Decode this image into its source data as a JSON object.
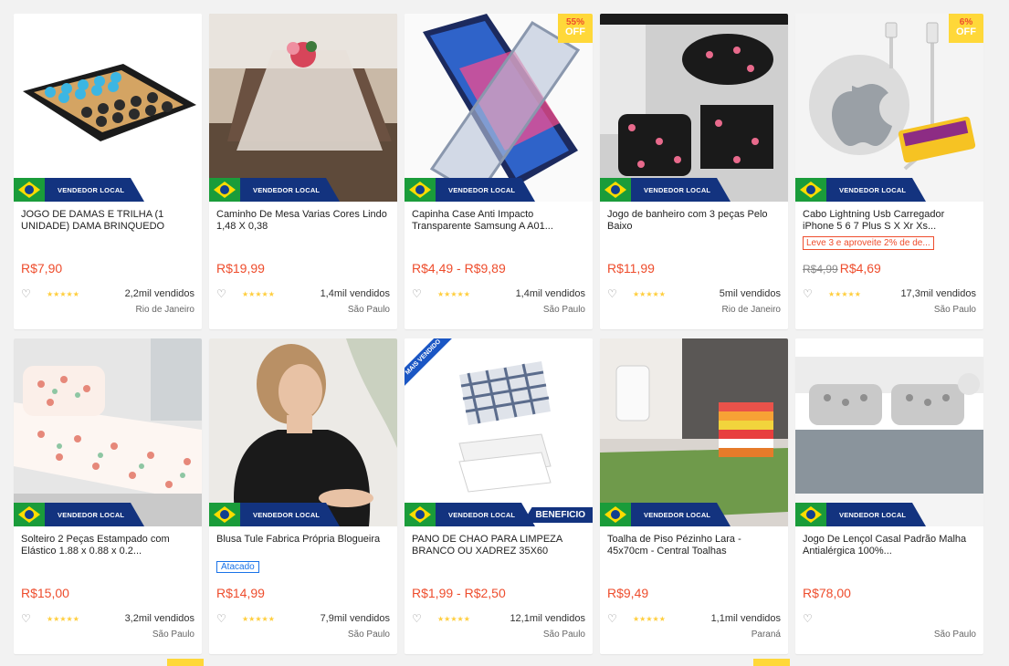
{
  "seller_badge": "VENDEDOR LOCAL",
  "colors": {
    "price": "#ee4d2d",
    "stars": "#ffce3d",
    "badge_bg": "#13337f",
    "discount_bg": "#ffd839"
  },
  "icons": {
    "favorite": "heart-outline-icon",
    "rating": "star-icon"
  },
  "products": [
    {
      "image": "checkers-board",
      "title": "JOGO DE DAMAS E TRILHA (1 UNIDADE) DAMA BRINQUEDO",
      "price": "R$7,90",
      "old_price": "",
      "promo": "",
      "tag": "",
      "discount_pct": "",
      "discount_off": "",
      "ribbon": "",
      "extra_banner": "",
      "stars": "★★★★★",
      "sold": "2,2mil vendidos",
      "location": "Rio de Janeiro"
    },
    {
      "image": "table-runner",
      "title": "Caminho De Mesa Varias Cores Lindo 1,48 X 0,38",
      "price": "R$19,99",
      "old_price": "",
      "promo": "",
      "tag": "",
      "discount_pct": "",
      "discount_off": "",
      "ribbon": "",
      "extra_banner": "",
      "stars": "★★★★★",
      "sold": "1,4mil vendidos",
      "location": "São Paulo"
    },
    {
      "image": "phone-case",
      "title": "Capinha Case Anti Impacto Transparente Samsung A A01...",
      "price": "R$4,49 - R$9,89",
      "old_price": "",
      "promo": "",
      "tag": "",
      "discount_pct": "55%",
      "discount_off": "OFF",
      "ribbon": "",
      "extra_banner": "",
      "stars": "★★★★★",
      "sold": "1,4mil vendidos",
      "location": "São Paulo"
    },
    {
      "image": "bath-set",
      "title": "Jogo de banheiro com 3 peças Pelo Baixo",
      "price": "R$11,99",
      "old_price": "",
      "promo": "",
      "tag": "",
      "discount_pct": "",
      "discount_off": "",
      "ribbon": "",
      "extra_banner": "",
      "stars": "★★★★★",
      "sold": "5mil vendidos",
      "location": "Rio de Janeiro"
    },
    {
      "image": "iphone-cable",
      "title": "Cabo Lightning Usb Carregador iPhone 5 6 7 Plus S X Xr Xs...",
      "price": "R$4,69",
      "old_price": "R$4,99",
      "promo": "Leve 3 e aproveite 2% de de...",
      "tag": "",
      "discount_pct": "6%",
      "discount_off": "OFF",
      "ribbon": "",
      "extra_banner": "",
      "stars": "★★★★★",
      "sold": "17,3mil vendidos",
      "location": "São Paulo"
    },
    {
      "image": "bedsheet-pattern",
      "title": "Solteiro 2 Peças Estampado com Elástico 1.88 x 0.88 x 0.2...",
      "price": "R$15,00",
      "old_price": "",
      "promo": "",
      "tag": "",
      "discount_pct": "",
      "discount_off": "",
      "ribbon": "",
      "extra_banner": "",
      "stars": "★★★★★",
      "sold": "3,2mil vendidos",
      "location": "São Paulo"
    },
    {
      "image": "blouse-model",
      "title": "Blusa Tule Fabrica Própria Blogueira",
      "price": "R$14,99",
      "old_price": "",
      "promo": "",
      "tag": "Atacado",
      "discount_pct": "",
      "discount_off": "",
      "ribbon": "",
      "extra_banner": "",
      "stars": "★★★★★",
      "sold": "7,9mil vendidos",
      "location": "São Paulo"
    },
    {
      "image": "cleaning-cloth",
      "title": "PANO DE CHAO PARA LIMPEZA BRANCO OU XADREZ 35X60",
      "price": "R$1,99 - R$2,50",
      "old_price": "",
      "promo": "",
      "tag": "",
      "discount_pct": "",
      "discount_off": "",
      "ribbon": "MAIS VENDIDO",
      "extra_banner": "BENEFICIO",
      "stars": "★★★★★",
      "sold": "12,1mil vendidos",
      "location": "São Paulo"
    },
    {
      "image": "bath-mat",
      "title": "Toalha de Piso Pézinho Lara - 45x70cm - Central Toalhas",
      "price": "R$9,49",
      "old_price": "",
      "promo": "",
      "tag": "",
      "discount_pct": "",
      "discount_off": "",
      "ribbon": "",
      "extra_banner": "",
      "stars": "★★★★★",
      "sold": "1,1mil vendidos",
      "location": "Paraná"
    },
    {
      "image": "bed-sheet-gray",
      "title": "Jogo De Lençol Casal Padrão Malha Antialérgica 100%...",
      "price": "R$78,00",
      "old_price": "",
      "promo": "",
      "tag": "",
      "discount_pct": "",
      "discount_off": "",
      "ribbon": "",
      "extra_banner": "",
      "stars": "",
      "sold": "",
      "location": "São Paulo"
    }
  ]
}
